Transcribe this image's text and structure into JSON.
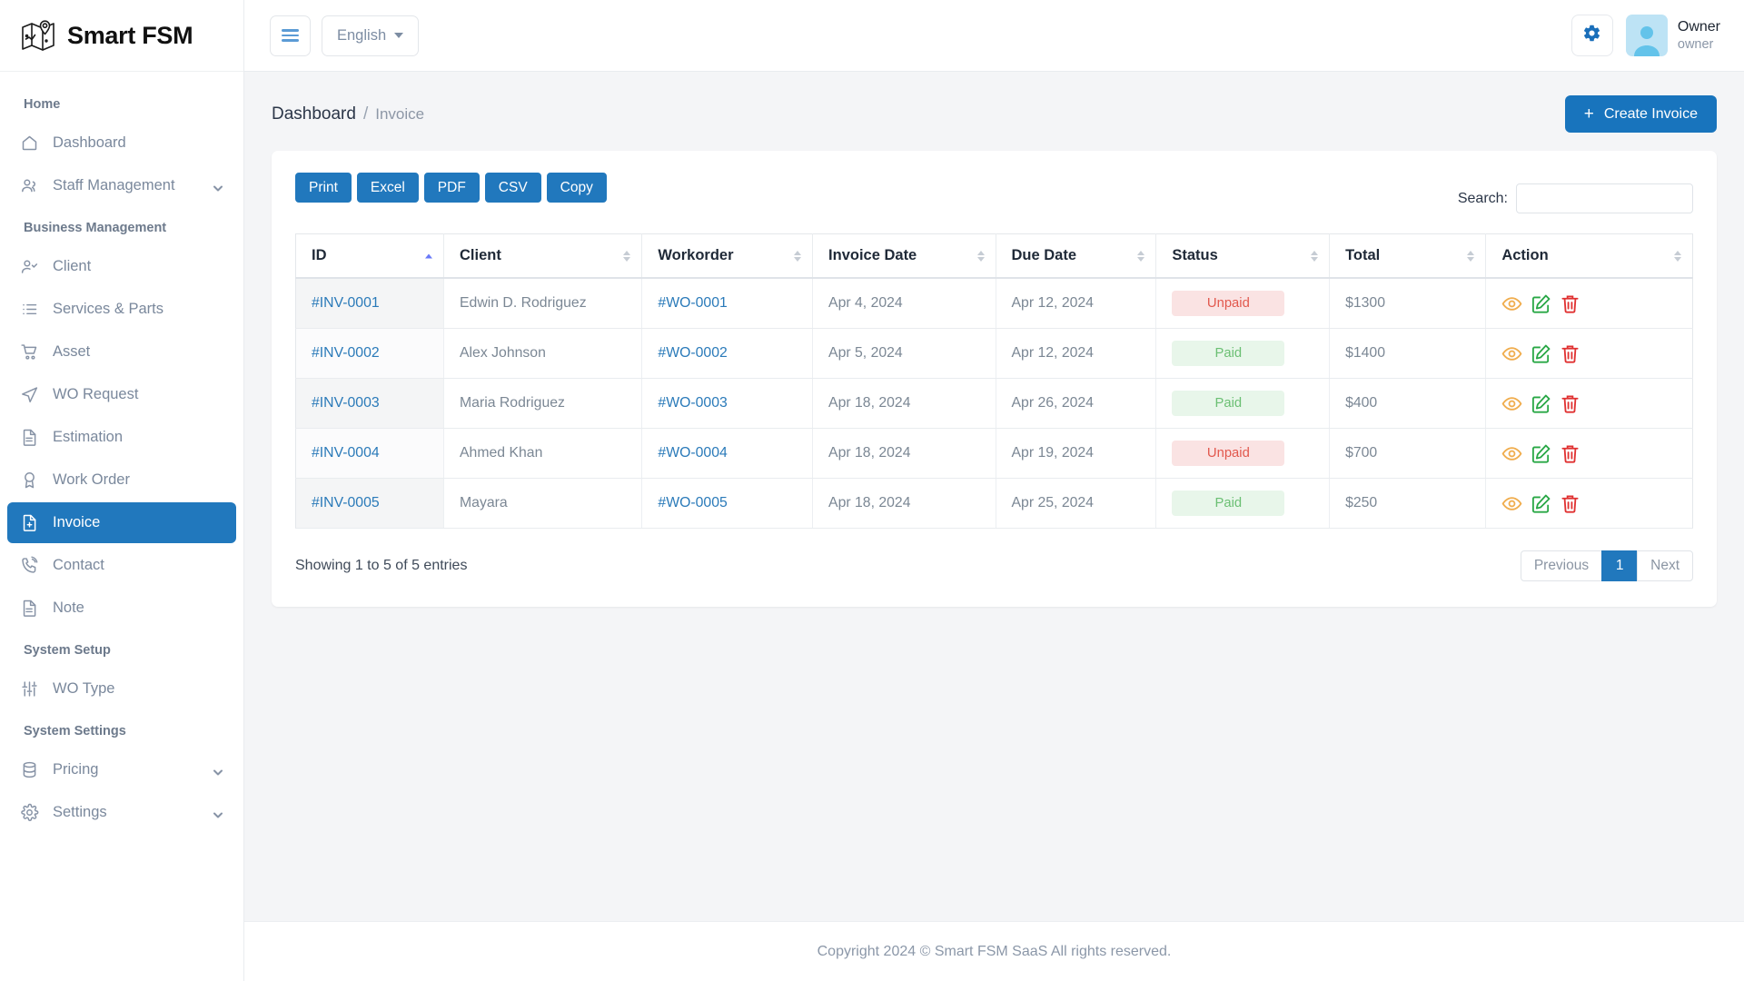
{
  "brand": {
    "name": "Smart FSM",
    "logo_icon": "map-pin-icon"
  },
  "topbar": {
    "menu_toggle_icon": "hamburger-icon",
    "language": "English",
    "settings_icon": "gear-icon",
    "user_name": "Owner",
    "user_role": "owner",
    "avatar_icon": "user-avatar-icon"
  },
  "sidebar": {
    "groups": [
      {
        "title": "Home",
        "items": [
          {
            "label": "Dashboard",
            "icon": "home-icon",
            "active": false,
            "expandable": false
          },
          {
            "label": "Staff Management",
            "icon": "users-icon",
            "active": false,
            "expandable": true
          }
        ]
      },
      {
        "title": "Business Management",
        "items": [
          {
            "label": "Client",
            "icon": "user-check-icon",
            "active": false,
            "expandable": false
          },
          {
            "label": "Services & Parts",
            "icon": "list-icon",
            "active": false,
            "expandable": false
          },
          {
            "label": "Asset",
            "icon": "cart-icon",
            "active": false,
            "expandable": false
          },
          {
            "label": "WO Request",
            "icon": "send-icon",
            "active": false,
            "expandable": false
          },
          {
            "label": "Estimation",
            "icon": "file-text-icon",
            "active": false,
            "expandable": false
          },
          {
            "label": "Work Order",
            "icon": "award-icon",
            "active": false,
            "expandable": false
          },
          {
            "label": "Invoice",
            "icon": "file-plus-icon",
            "active": true,
            "expandable": false
          },
          {
            "label": "Contact",
            "icon": "phone-call-icon",
            "active": false,
            "expandable": false
          },
          {
            "label": "Note",
            "icon": "file-text-icon",
            "active": false,
            "expandable": false
          }
        ]
      },
      {
        "title": "System Setup",
        "items": [
          {
            "label": "WO Type",
            "icon": "sliders-icon",
            "active": false,
            "expandable": false
          }
        ]
      },
      {
        "title": "System Settings",
        "items": [
          {
            "label": "Pricing",
            "icon": "database-icon",
            "active": false,
            "expandable": true
          },
          {
            "label": "Settings",
            "icon": "gear-icon",
            "active": false,
            "expandable": true
          }
        ]
      }
    ]
  },
  "breadcrumb": {
    "root": "Dashboard",
    "separator": "/",
    "current": "Invoice"
  },
  "page_actions": {
    "create_label": "Create Invoice",
    "create_icon": "plus-icon"
  },
  "datatable": {
    "export_buttons": [
      "Print",
      "Excel",
      "PDF",
      "CSV",
      "Copy"
    ],
    "search_label": "Search:",
    "search_value": "",
    "search_placeholder": "",
    "columns": [
      {
        "label": "ID",
        "sort": "asc"
      },
      {
        "label": "Client",
        "sort": "none"
      },
      {
        "label": "Workorder",
        "sort": "none"
      },
      {
        "label": "Invoice Date",
        "sort": "none"
      },
      {
        "label": "Due Date",
        "sort": "none"
      },
      {
        "label": "Status",
        "sort": "none"
      },
      {
        "label": "Total",
        "sort": "none"
      },
      {
        "label": "Action",
        "sort": "none"
      }
    ],
    "rows": [
      {
        "id": "#INV-0001",
        "client": "Edwin D. Rodriguez",
        "workorder": "#WO-0001",
        "invoice_date": "Apr 4, 2024",
        "due_date": "Apr 12, 2024",
        "status": "Unpaid",
        "status_kind": "unpaid",
        "total": "$1300"
      },
      {
        "id": "#INV-0002",
        "client": "Alex Johnson",
        "workorder": "#WO-0002",
        "invoice_date": "Apr 5, 2024",
        "due_date": "Apr 12, 2024",
        "status": "Paid",
        "status_kind": "paid",
        "total": "$1400"
      },
      {
        "id": "#INV-0003",
        "client": "Maria Rodriguez",
        "workorder": "#WO-0003",
        "invoice_date": "Apr 18, 2024",
        "due_date": "Apr 26, 2024",
        "status": "Paid",
        "status_kind": "paid",
        "total": "$400"
      },
      {
        "id": "#INV-0004",
        "client": "Ahmed Khan",
        "workorder": "#WO-0004",
        "invoice_date": "Apr 18, 2024",
        "due_date": "Apr 19, 2024",
        "status": "Unpaid",
        "status_kind": "unpaid",
        "total": "$700"
      },
      {
        "id": "#INV-0005",
        "client": "Mayara",
        "workorder": "#WO-0005",
        "invoice_date": "Apr 18, 2024",
        "due_date": "Apr 25, 2024",
        "status": "Paid",
        "status_kind": "paid",
        "total": "$250"
      }
    ],
    "row_action_icons": [
      "eye-icon",
      "edit-icon",
      "trash-icon"
    ],
    "showing_text": "Showing 1 to 5 of 5 entries",
    "pagination": {
      "previous": "Previous",
      "pages": [
        "1"
      ],
      "current_page": "1",
      "next": "Next"
    }
  },
  "footer": {
    "text": "Copyright 2024 © Smart FSM SaaS All rights reserved."
  },
  "colors": {
    "primary": "#2178bd",
    "accent_blue": "#1874bd",
    "link": "#2a7ab9",
    "paid_text": "#6bbf73",
    "paid_bg": "#e8f6ea",
    "unpaid_text": "#e2584d",
    "unpaid_bg": "#fae3e3",
    "eye_icon": "#f0ad4e",
    "edit_icon": "#28a745",
    "trash_icon": "#e03131",
    "sidebar_text": "#7a889c",
    "page_bg": "#f4f5f7"
  }
}
